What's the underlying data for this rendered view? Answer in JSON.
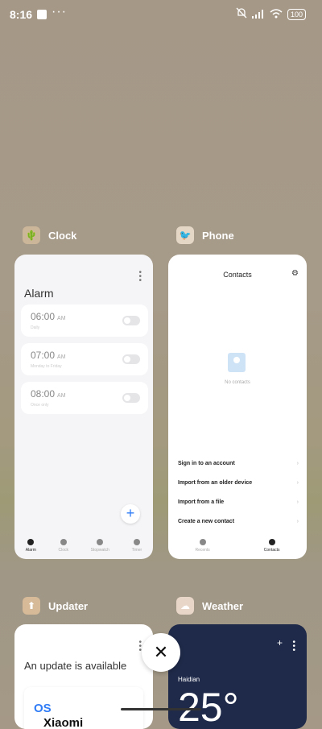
{
  "status_bar": {
    "time": "8:16",
    "dots": "···",
    "battery": "100",
    "icons": [
      "notifications-off-icon",
      "signal-icon",
      "wifi-icon",
      "battery-icon"
    ]
  },
  "apps": {
    "clock": {
      "label": "Clock",
      "card": {
        "title": "Alarm",
        "alarms": [
          {
            "time": "06:00",
            "ampm": "AM",
            "sub": "Daily"
          },
          {
            "time": "07:00",
            "ampm": "AM",
            "sub": "Monday to Friday"
          },
          {
            "time": "08:00",
            "ampm": "AM",
            "sub": "Once only"
          }
        ],
        "fab": "+",
        "tabs": [
          "Alarm",
          "Clock",
          "Stopwatch",
          "Timer"
        ]
      }
    },
    "phone": {
      "label": "Phone",
      "card": {
        "title": "Contacts",
        "empty": "No contacts",
        "menu": [
          {
            "label": "Sign in to an account"
          },
          {
            "label": "Import from an older device"
          },
          {
            "label": "Import from a file"
          },
          {
            "label": "Create a new contact"
          }
        ],
        "tabs": [
          "Recents",
          "Contacts"
        ]
      }
    },
    "updater": {
      "label": "Updater",
      "card": {
        "headline": "An update is available",
        "logo_main": "Xiaomi Hyper",
        "logo_accent": "OS"
      }
    },
    "weather": {
      "label": "Weather",
      "card": {
        "city": "Haidian",
        "temp": "25°"
      }
    }
  },
  "close_button": "✕",
  "colors": {
    "accent": "#2f7cf6",
    "weather_bg": "#1f2a4a"
  }
}
